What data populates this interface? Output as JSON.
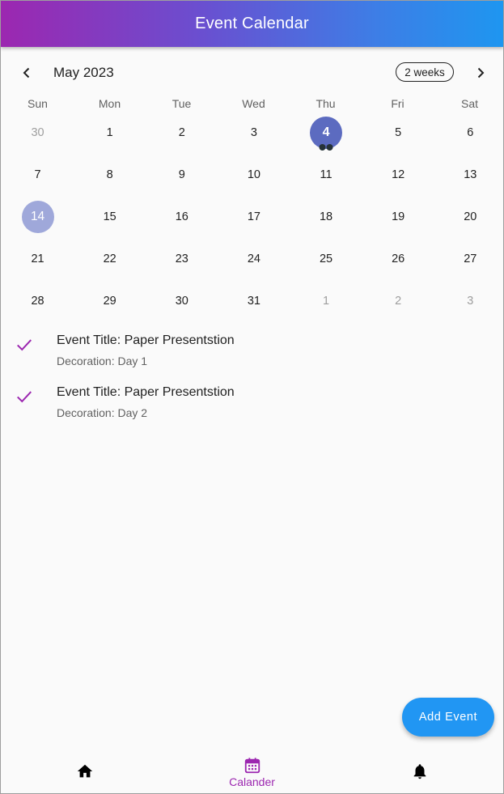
{
  "app": {
    "title": "Event Calendar"
  },
  "calendar": {
    "month_title": "May 2023",
    "format_button": "2 weeks",
    "weekdays": [
      "Sun",
      "Mon",
      "Tue",
      "Wed",
      "Thu",
      "Fri",
      "Sat"
    ],
    "weeks": [
      [
        {
          "d": "30",
          "o": true
        },
        {
          "d": "1"
        },
        {
          "d": "2"
        },
        {
          "d": "3"
        },
        {
          "d": "4",
          "selected": true,
          "events": 2
        },
        {
          "d": "5"
        },
        {
          "d": "6"
        }
      ],
      [
        {
          "d": "7"
        },
        {
          "d": "8"
        },
        {
          "d": "9"
        },
        {
          "d": "10"
        },
        {
          "d": "11"
        },
        {
          "d": "12"
        },
        {
          "d": "13"
        }
      ],
      [
        {
          "d": "14",
          "today": true
        },
        {
          "d": "15"
        },
        {
          "d": "16"
        },
        {
          "d": "17"
        },
        {
          "d": "18"
        },
        {
          "d": "19"
        },
        {
          "d": "20"
        }
      ],
      [
        {
          "d": "21"
        },
        {
          "d": "22"
        },
        {
          "d": "23"
        },
        {
          "d": "24"
        },
        {
          "d": "25"
        },
        {
          "d": "26"
        },
        {
          "d": "27"
        }
      ],
      [
        {
          "d": "28"
        },
        {
          "d": "29"
        },
        {
          "d": "30"
        },
        {
          "d": "31"
        },
        {
          "d": "1",
          "o": true
        },
        {
          "d": "2",
          "o": true
        },
        {
          "d": "3",
          "o": true
        }
      ]
    ],
    "colors": {
      "selected": "#5c6bc0",
      "today": "#9fa8da",
      "marker": "#263238"
    }
  },
  "events": [
    {
      "title": "Event Title: Paper Presentstion",
      "subtitle": "Decoration: Day 1",
      "icon": "check-icon"
    },
    {
      "title": "Event Title: Paper Presentstion",
      "subtitle": "Decoration: Day 2",
      "icon": "check-icon"
    }
  ],
  "fab": {
    "label": "Add Event",
    "color": "#2196f3"
  },
  "bottom_nav": {
    "items": [
      {
        "icon": "home-icon",
        "label": ""
      },
      {
        "icon": "calendar-icon",
        "label": "Calander",
        "active": true
      },
      {
        "icon": "bell-icon",
        "label": ""
      }
    ],
    "active_color": "#9c27b0"
  },
  "theme": {
    "app_bar_gradient": [
      "#9c27b0",
      "#1e96f0"
    ],
    "check_color": "#9c27b0"
  }
}
